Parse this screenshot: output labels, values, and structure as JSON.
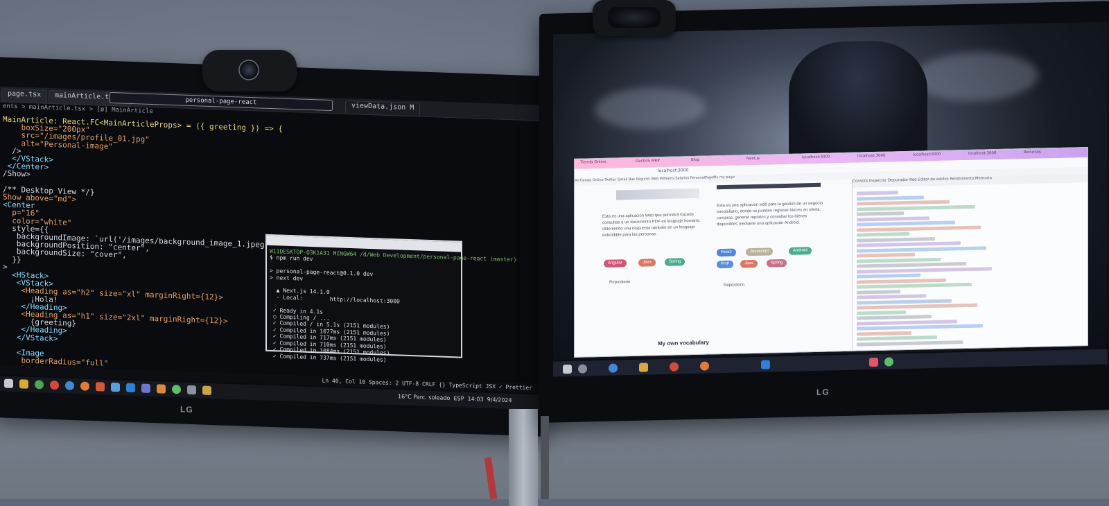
{
  "left_monitor": {
    "tabs": [
      "page.tsx",
      "mainArticle.tsx M",
      "viewData.json M"
    ],
    "search_text": "personal-page-react",
    "breadcrumb": "ents > mainArticle.tsx > [ø] MainArticle",
    "code_lines": [
      "MainArticle: React.FC<MainArticleProps> = ({ greeting }) => {",
      "    boxSize=\"200px\"",
      "    src=\"/images/profile_01.jpg\"",
      "    alt=\"Personal-image\"",
      "  />",
      "  </VStack>",
      " </Center>",
      "/Show>",
      "",
      "/** Desktop View */}",
      "Show above=\"md\">",
      "<Center",
      "  p=\"16\"",
      "  color=\"white\"",
      "  style={{",
      "   backgroundImage: `url('/images/background_image_1.jpeg')`,",
      "   backgroundPosition: \"center\",",
      "   backgroundSize: \"cover\",",
      "  }}",
      ">",
      "  <HStack>",
      "   <VStack>",
      "    <Heading as=\"h2\" size=\"xl\" marginRight={12}>",
      "      ¡Hola!",
      "    </Heading>",
      "    <Heading as=\"h1\" size=\"2xl\" marginRight={12}>",
      "      {greeting}",
      "    </Heading>",
      "   </VStack>",
      "",
      "   <Image",
      "    borderRadius=\"full\"",
      "    boxSize=\"200px\""
    ],
    "terminal": {
      "lines": [
        "W11DESKTOP-Q3K1A31 MINGW64 /d/Web Development/personal-page-react (master)",
        "$ npm run dev",
        "",
        "> personal-page-react@0.1.0 dev",
        "> next dev",
        "",
        "  ▲ Next.js 14.1.0",
        "  - Local:        http://localhost:3000",
        "",
        " ✓ Ready in 4.1s",
        " ○ Compiling / ...",
        " ✓ Compiled / in 5.1s (2151 modules)",
        " ✓ Compiled in 1077ms (2151 modules)",
        " ✓ Compiled in 717ms (2151 modules)",
        " ✓ Compiled in 710ms (2151 modules)",
        " ✓ Compiled in 1084ms (2151 modules)",
        " ✓ Compiled in 737ms (2151 modules)"
      ]
    },
    "status_bar": "Ln 40, Col 10   Spaces: 2   UTF-8   CRLF   {} TypeScript JSX   ✓ Prettier",
    "weather": "16°C  Parc. soleado",
    "lang": "ESP",
    "clock_time": "14:03",
    "clock_date": "9/4/2024",
    "brand": "LG"
  },
  "right_monitor": {
    "browser_tabs": [
      "Tienda Online",
      "Gestión MRP",
      "Blog",
      "Next.js",
      "localhost:3000",
      "localhost:3000",
      "localhost:3000",
      "localhost:3000",
      "Recursos"
    ],
    "url": "localhost:3000",
    "bookmarks": "Mi Tienda Online   Twitter   Gmail   Bas Seguros Web   Williams Salarios   PersonalPageMy   my page",
    "cards": [
      {
        "text": "Esta es una aplicación Web que permitirá hacerle consultas a un documento PDF en lenguaje humano, obteniendo una respuesta también en un lenguaje entendible para las personas.",
        "badges": [
          {
            "label": "Angular",
            "color": "#d2567a"
          },
          {
            "label": "Java",
            "color": "#d97764"
          },
          {
            "label": "Spring",
            "color": "#4dab8c"
          }
        ],
        "repo_label": "Repositorio"
      },
      {
        "text": "Esta es una aplicación web para la gestión de un negocio inmobiliario, donde se pueden registrar bienes en oferta, compras, generar reportes y consultar los bienes disponibles mediante una aplicación Android.",
        "badges": [
          {
            "label": "React",
            "color": "#4f86d9"
          },
          {
            "label": "Javascript",
            "color": "#b9b29d"
          },
          {
            "label": "Android",
            "color": "#4caf8c"
          },
          {
            "label": "PHP",
            "color": "#5c8ed6"
          },
          {
            "label": "Java",
            "color": "#d97764"
          },
          {
            "label": "Spring",
            "color": "#c8708a"
          }
        ],
        "repo_label": "Repositorio"
      }
    ],
    "section_title": "My own vocabulary",
    "devtools_tabs": "Consola   Inspector   Depurador   Red   Editor de estilos   Rendimiento   Memoria",
    "brand": "LG"
  }
}
